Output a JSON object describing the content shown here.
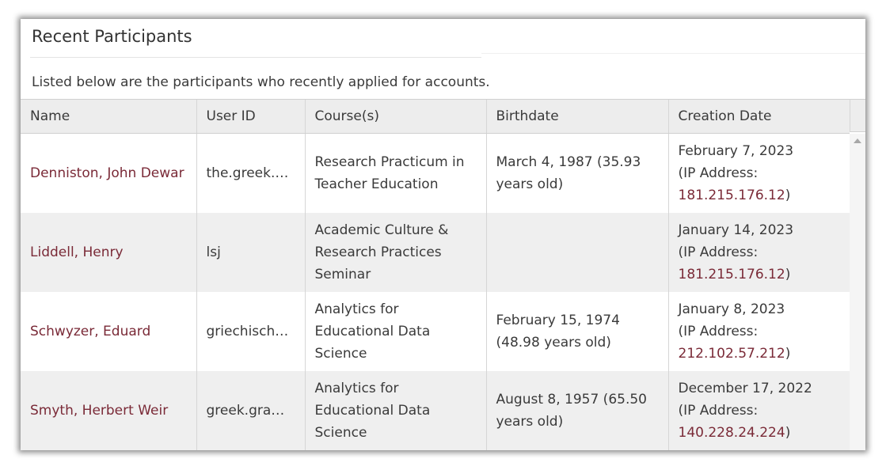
{
  "panel": {
    "title": "Recent Participants",
    "description": "Listed below are the participants who recently applied for accounts."
  },
  "table": {
    "headers": [
      "Name",
      "User ID",
      "Course(s)",
      "Birthdate",
      "Creation Date"
    ],
    "ip_label": "(IP Address:",
    "ip_close": ")",
    "rows": [
      {
        "name": "Denniston, John Dewar",
        "user_id": "the.greek.particles",
        "course": "Research Practicum in Teacher Education",
        "birthdate": "March 4, 1987 (35.93 years old)",
        "created": "February 7, 2023",
        "ip": "181.215.176.12"
      },
      {
        "name": "Liddell, Henry",
        "user_id": "lsj",
        "course": "Academic Culture & Research Practices Seminar",
        "birthdate": "",
        "created": "January 14, 2023",
        "ip": "181.215.176.12"
      },
      {
        "name": "Schwyzer, Eduard",
        "user_id": "griechische.grammatik",
        "course": "Analytics for Educational Data Science",
        "birthdate": "February 15, 1974 (48.98 years old)",
        "created": "January 8, 2023",
        "ip": "212.102.57.212"
      },
      {
        "name": "Smyth, Herbert Weir",
        "user_id": "greek.grammar",
        "course": "Analytics for Educational Data Science",
        "birthdate": "August 8, 1957 (65.50 years old)",
        "created": "December 17, 2022",
        "ip": "140.228.24.224"
      }
    ]
  },
  "icons": {
    "scroll_up": "scroll-up-arrow-icon"
  },
  "colors": {
    "link": "#7a2a37",
    "header_bg": "#ededed",
    "row_alt_bg": "#efefef"
  }
}
